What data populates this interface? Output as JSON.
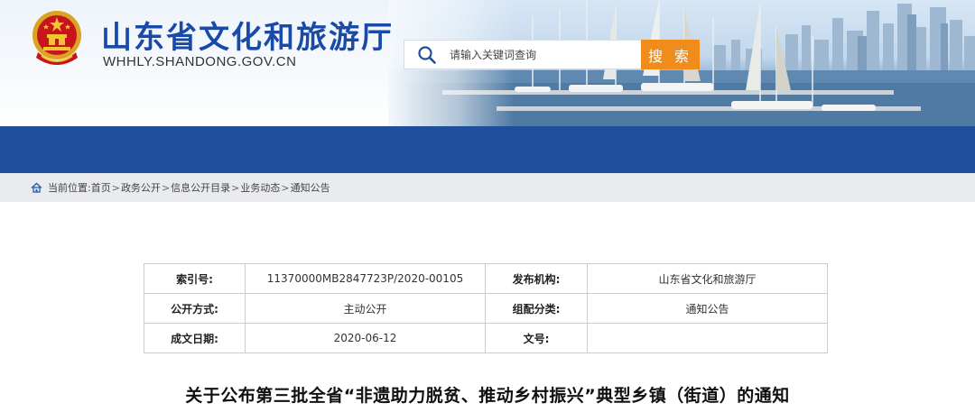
{
  "header": {
    "site_title": "山东省文化和旅游厅",
    "site_domain": "WHHLY.SHANDONG.GOV.CN",
    "emblem_icon": "national-emblem-icon",
    "search": {
      "placeholder": "请输入关键词查询",
      "button_label": "搜 索",
      "icon": "search-icon"
    }
  },
  "breadcrumb": {
    "prefix": "当前位置:",
    "items": [
      "首页",
      "政务公开",
      "信息公开目录",
      "业务动态",
      "通知公告"
    ],
    "separator": ">"
  },
  "info_table": {
    "rows": [
      {
        "k1": "索引号:",
        "v1": "11370000MB2847723P/2020-00105",
        "k2": "发布机构:",
        "v2": "山东省文化和旅游厅"
      },
      {
        "k1": "公开方式:",
        "v1": "主动公开",
        "k2": "组配分类:",
        "v2": "通知公告"
      },
      {
        "k1": "成文日期:",
        "v1": "2020-06-12",
        "k2": "文号:",
        "v2": ""
      }
    ]
  },
  "article": {
    "title": "关于公布第三批全省“非遗助力脱贫、推动乡村振兴”典型乡镇（街道）的通知"
  },
  "colors": {
    "title_blue": "#1a4aa8",
    "nav_blue": "#1f4f9c",
    "search_orange": "#f08c1c",
    "breadcrumb_bg": "#e9ebef"
  }
}
